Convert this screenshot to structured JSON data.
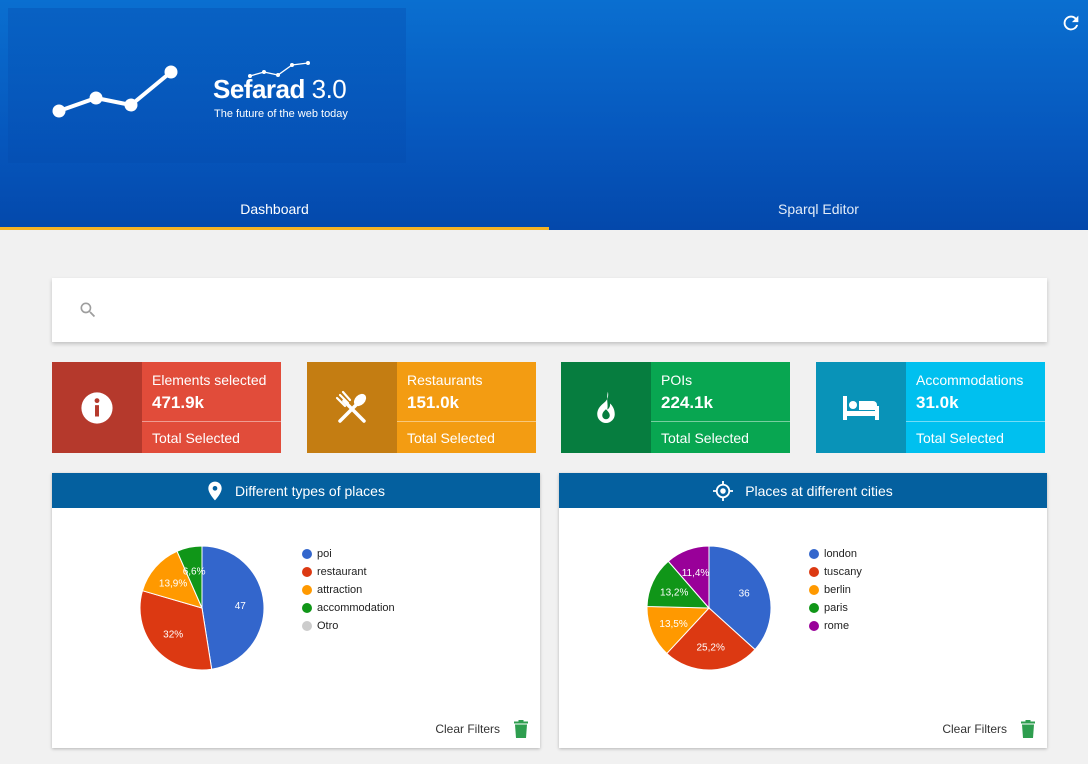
{
  "brand": {
    "name": "Sefarad",
    "version": "3.0",
    "tagline": "The future of the web today"
  },
  "tabs": [
    {
      "label": "Dashboard",
      "active": true
    },
    {
      "label": "Sparql Editor",
      "active": false
    }
  ],
  "search": {
    "placeholder": "",
    "value": ""
  },
  "stats": [
    {
      "label": "Elements selected",
      "value": "471.9k",
      "footer": "Total Selected",
      "icon": "info-icon",
      "icon_bg": "#b5392c",
      "bg": "#e14c3a"
    },
    {
      "label": "Restaurants",
      "value": "151.0k",
      "footer": "Total Selected",
      "icon": "restaurant-icon",
      "icon_bg": "#c47d12",
      "bg": "#f39c12"
    },
    {
      "label": "POIs",
      "value": "224.1k",
      "footer": "Total Selected",
      "icon": "fire-icon",
      "icon_bg": "#067d3f",
      "bg": "#08a651"
    },
    {
      "label": "Accommodations",
      "value": "31.0k",
      "footer": "Total Selected",
      "icon": "bed-icon",
      "icon_bg": "#0993b8",
      "bg": "#00c0ef"
    }
  ],
  "panels": [
    {
      "title": "Different types of places",
      "icon": "location-pin-icon",
      "clear_label": "Clear Filters"
    },
    {
      "title": "Places at different cities",
      "icon": "target-icon",
      "clear_label": "Clear Filters"
    }
  ],
  "chart_data": [
    {
      "type": "pie",
      "categories": [
        "poi",
        "restaurant",
        "attraction",
        "accommodation",
        "Otro"
      ],
      "values": [
        47.5,
        32,
        13.9,
        6.6,
        0
      ],
      "labels": [
        "47",
        "32%",
        "13,9%",
        "6,6%",
        ""
      ],
      "colors": [
        "#3366cc",
        "#dc3912",
        "#ff9900",
        "#109618",
        "#cccccc"
      ]
    },
    {
      "type": "pie",
      "categories": [
        "london",
        "tuscany",
        "berlin",
        "paris",
        "rome"
      ],
      "values": [
        36.7,
        25.2,
        13.5,
        13.2,
        11.4
      ],
      "labels": [
        "36",
        "25,2%",
        "13,5%",
        "13,2%",
        "11,4%"
      ],
      "colors": [
        "#3366cc",
        "#dc3912",
        "#ff9900",
        "#109618",
        "#990099"
      ]
    }
  ]
}
